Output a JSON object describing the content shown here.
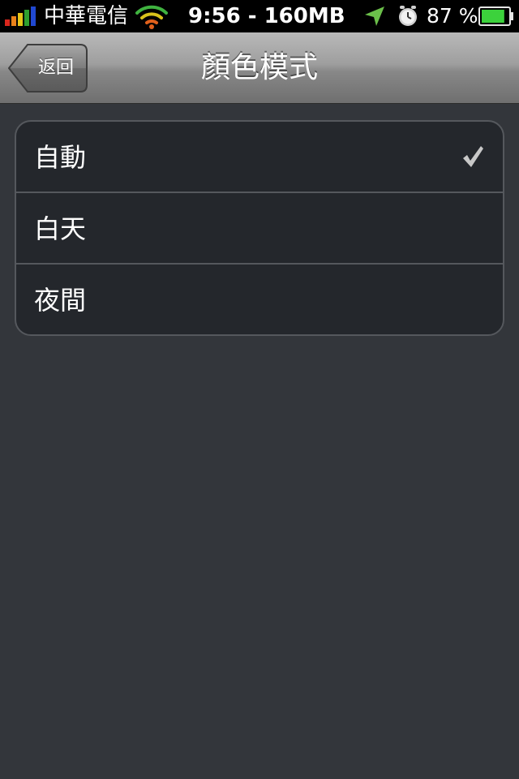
{
  "status_bar": {
    "carrier": "中華電信",
    "time_memory": "9:56 - 160MB",
    "battery_percent": "87 %",
    "battery_level": 0.87,
    "icons": [
      "signal-icon",
      "wifi-icon",
      "location-arrow-icon",
      "alarm-clock-icon",
      "battery-icon"
    ]
  },
  "nav": {
    "back_label": "返回",
    "title": "顏色模式"
  },
  "options": [
    {
      "label": "自動",
      "selected": true
    },
    {
      "label": "白天",
      "selected": false
    },
    {
      "label": "夜間",
      "selected": false
    }
  ],
  "colors": {
    "background": "#33363b",
    "list_background": "#24272c",
    "separator": "#55585d",
    "checkmark": "#c8c8c8",
    "battery_fill": "#3cd23c"
  }
}
